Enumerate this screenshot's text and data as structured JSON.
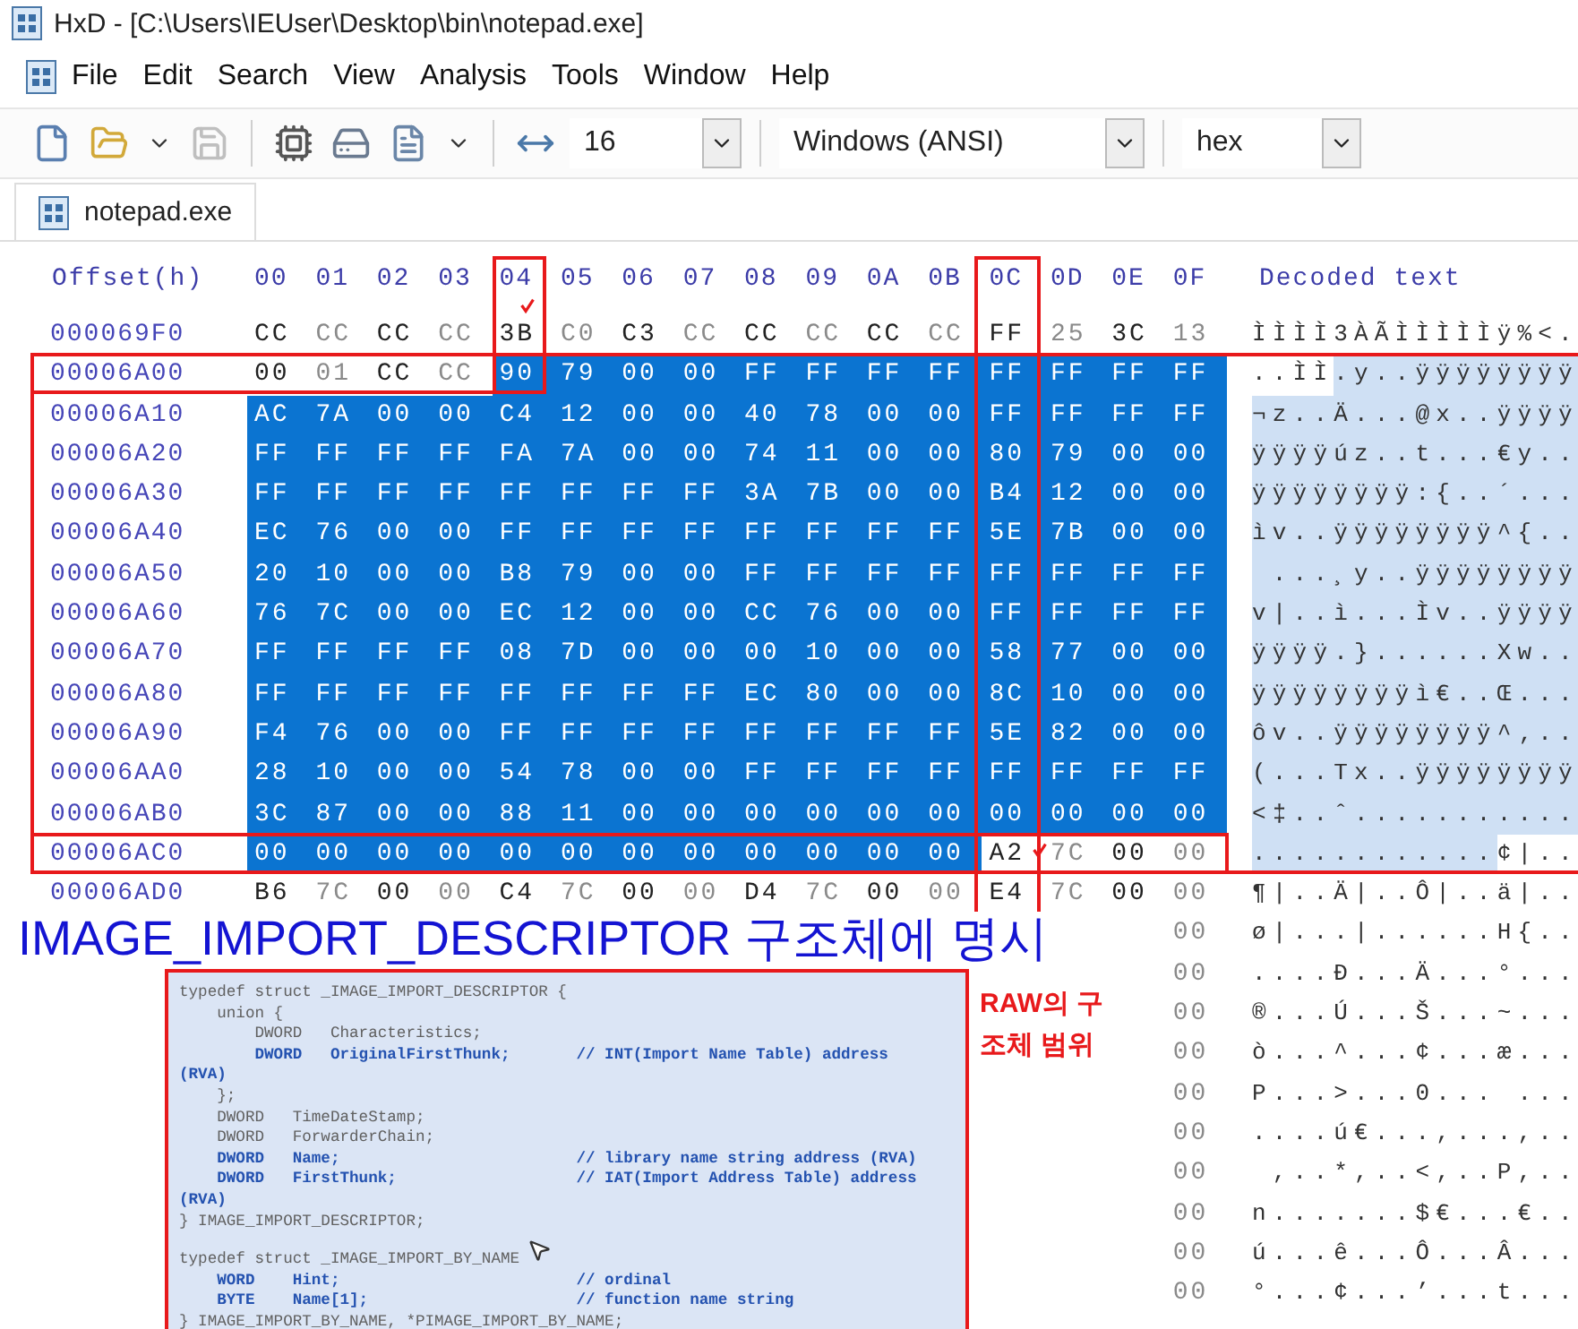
{
  "window": {
    "title": "HxD - [C:\\Users\\IEUser\\Desktop\\bin\\notepad.exe]"
  },
  "menu": [
    "File",
    "Edit",
    "Search",
    "View",
    "Analysis",
    "Tools",
    "Window",
    "Help"
  ],
  "toolbar": {
    "bytes_per_row": "16",
    "encoding": "Windows (ANSI)",
    "offset_base": "hex"
  },
  "tabs": [
    {
      "label": "notepad.exe",
      "selected": true
    }
  ],
  "hex_view": {
    "offset_header": "Offset(h)",
    "columns": [
      "00",
      "01",
      "02",
      "03",
      "04",
      "05",
      "06",
      "07",
      "08",
      "09",
      "0A",
      "0B",
      "0C",
      "0D",
      "0E",
      "0F"
    ],
    "decoded_header": "Decoded text",
    "rows": [
      {
        "offset": "000069F0",
        "bytes": [
          "CC",
          "CC",
          "CC",
          "CC",
          "3B",
          "C0",
          "C3",
          "CC",
          "CC",
          "CC",
          "CC",
          "CC",
          "FF",
          "25",
          "3C",
          "13"
        ],
        "selected": [
          false,
          false,
          false,
          false,
          false,
          false,
          false,
          false,
          false,
          false,
          false,
          false,
          false,
          false,
          false,
          false
        ],
        "decoded": "ÌÌÌÌ3ÀÃÌÌÌÌÌÿ%<."
      },
      {
        "offset": "00006A00",
        "bytes": [
          "00",
          "01",
          "CC",
          "CC",
          "90",
          "79",
          "00",
          "00",
          "FF",
          "FF",
          "FF",
          "FF",
          "FF",
          "FF",
          "FF",
          "FF"
        ],
        "selected": [
          false,
          false,
          false,
          false,
          true,
          true,
          true,
          true,
          true,
          true,
          true,
          true,
          true,
          true,
          true,
          true
        ],
        "decoded": "..ÌÌ.y..ÿÿÿÿÿÿÿÿ"
      },
      {
        "offset": "00006A10",
        "bytes": [
          "AC",
          "7A",
          "00",
          "00",
          "C4",
          "12",
          "00",
          "00",
          "40",
          "78",
          "00",
          "00",
          "FF",
          "FF",
          "FF",
          "FF"
        ],
        "selected": [
          true,
          true,
          true,
          true,
          true,
          true,
          true,
          true,
          true,
          true,
          true,
          true,
          true,
          true,
          true,
          true
        ],
        "decoded": "¬z..Ä...@x..ÿÿÿÿ"
      },
      {
        "offset": "00006A20",
        "bytes": [
          "FF",
          "FF",
          "FF",
          "FF",
          "FA",
          "7A",
          "00",
          "00",
          "74",
          "11",
          "00",
          "00",
          "80",
          "79",
          "00",
          "00"
        ],
        "selected": [
          true,
          true,
          true,
          true,
          true,
          true,
          true,
          true,
          true,
          true,
          true,
          true,
          true,
          true,
          true,
          true
        ],
        "decoded": "ÿÿÿÿúz..t...€y.."
      },
      {
        "offset": "00006A30",
        "bytes": [
          "FF",
          "FF",
          "FF",
          "FF",
          "FF",
          "FF",
          "FF",
          "FF",
          "3A",
          "7B",
          "00",
          "00",
          "B4",
          "12",
          "00",
          "00"
        ],
        "selected": [
          true,
          true,
          true,
          true,
          true,
          true,
          true,
          true,
          true,
          true,
          true,
          true,
          true,
          true,
          true,
          true
        ],
        "decoded": "ÿÿÿÿÿÿÿÿ:{..´..."
      },
      {
        "offset": "00006A40",
        "bytes": [
          "EC",
          "76",
          "00",
          "00",
          "FF",
          "FF",
          "FF",
          "FF",
          "FF",
          "FF",
          "FF",
          "FF",
          "5E",
          "7B",
          "00",
          "00"
        ],
        "selected": [
          true,
          true,
          true,
          true,
          true,
          true,
          true,
          true,
          true,
          true,
          true,
          true,
          true,
          true,
          true,
          true
        ],
        "decoded": "ìv..ÿÿÿÿÿÿÿÿ^{.."
      },
      {
        "offset": "00006A50",
        "bytes": [
          "20",
          "10",
          "00",
          "00",
          "B8",
          "79",
          "00",
          "00",
          "FF",
          "FF",
          "FF",
          "FF",
          "FF",
          "FF",
          "FF",
          "FF"
        ],
        "selected": [
          true,
          true,
          true,
          true,
          true,
          true,
          true,
          true,
          true,
          true,
          true,
          true,
          true,
          true,
          true,
          true
        ],
        "decoded": " ...¸y..ÿÿÿÿÿÿÿÿ"
      },
      {
        "offset": "00006A60",
        "bytes": [
          "76",
          "7C",
          "00",
          "00",
          "EC",
          "12",
          "00",
          "00",
          "CC",
          "76",
          "00",
          "00",
          "FF",
          "FF",
          "FF",
          "FF"
        ],
        "selected": [
          true,
          true,
          true,
          true,
          true,
          true,
          true,
          true,
          true,
          true,
          true,
          true,
          true,
          true,
          true,
          true
        ],
        "decoded": "v|..ì...Ìv..ÿÿÿÿ"
      },
      {
        "offset": "00006A70",
        "bytes": [
          "FF",
          "FF",
          "FF",
          "FF",
          "08",
          "7D",
          "00",
          "00",
          "00",
          "10",
          "00",
          "00",
          "58",
          "77",
          "00",
          "00"
        ],
        "selected": [
          true,
          true,
          true,
          true,
          true,
          true,
          true,
          true,
          true,
          true,
          true,
          true,
          true,
          true,
          true,
          true
        ],
        "decoded": "ÿÿÿÿ.}......Xw.."
      },
      {
        "offset": "00006A80",
        "bytes": [
          "FF",
          "FF",
          "FF",
          "FF",
          "FF",
          "FF",
          "FF",
          "FF",
          "EC",
          "80",
          "00",
          "00",
          "8C",
          "10",
          "00",
          "00"
        ],
        "selected": [
          true,
          true,
          true,
          true,
          true,
          true,
          true,
          true,
          true,
          true,
          true,
          true,
          true,
          true,
          true,
          true
        ],
        "decoded": "ÿÿÿÿÿÿÿÿì€..Œ..."
      },
      {
        "offset": "00006A90",
        "bytes": [
          "F4",
          "76",
          "00",
          "00",
          "FF",
          "FF",
          "FF",
          "FF",
          "FF",
          "FF",
          "FF",
          "FF",
          "5E",
          "82",
          "00",
          "00"
        ],
        "selected": [
          true,
          true,
          true,
          true,
          true,
          true,
          true,
          true,
          true,
          true,
          true,
          true,
          true,
          true,
          true,
          true
        ],
        "decoded": "ôv..ÿÿÿÿÿÿÿÿ^‚.."
      },
      {
        "offset": "00006AA0",
        "bytes": [
          "28",
          "10",
          "00",
          "00",
          "54",
          "78",
          "00",
          "00",
          "FF",
          "FF",
          "FF",
          "FF",
          "FF",
          "FF",
          "FF",
          "FF"
        ],
        "selected": [
          true,
          true,
          true,
          true,
          true,
          true,
          true,
          true,
          true,
          true,
          true,
          true,
          true,
          true,
          true,
          true
        ],
        "decoded": "(...Tx..ÿÿÿÿÿÿÿÿ"
      },
      {
        "offset": "00006AB0",
        "bytes": [
          "3C",
          "87",
          "00",
          "00",
          "88",
          "11",
          "00",
          "00",
          "00",
          "00",
          "00",
          "00",
          "00",
          "00",
          "00",
          "00"
        ],
        "selected": [
          true,
          true,
          true,
          true,
          true,
          true,
          true,
          true,
          true,
          true,
          true,
          true,
          true,
          true,
          true,
          true
        ],
        "decoded": "<‡..ˆ..........."
      },
      {
        "offset": "00006AC0",
        "bytes": [
          "00",
          "00",
          "00",
          "00",
          "00",
          "00",
          "00",
          "00",
          "00",
          "00",
          "00",
          "00",
          "A2",
          "7C",
          "00",
          "00"
        ],
        "selected": [
          true,
          true,
          true,
          true,
          true,
          true,
          true,
          true,
          true,
          true,
          true,
          true,
          false,
          false,
          false,
          false
        ],
        "decoded": "............¢|.."
      },
      {
        "offset": "00006AD0",
        "bytes": [
          "B6",
          "7C",
          "00",
          "00",
          "C4",
          "7C",
          "00",
          "00",
          "D4",
          "7C",
          "00",
          "00",
          "E4",
          "7C",
          "00",
          "00"
        ],
        "selected": [
          false,
          false,
          false,
          false,
          false,
          false,
          false,
          false,
          false,
          false,
          false,
          false,
          false,
          false,
          false,
          false
        ],
        "decoded": "¶|..Ä|..Ô|..ä|.."
      }
    ],
    "covered_rows": [
      {
        "last_byte": "00",
        "decoded": "ø|...|......H{.."
      },
      {
        "last_byte": "00",
        "decoded": "....Ð...Ä...°..."
      },
      {
        "last_byte": "00",
        "decoded": "®...Ú...Š...~..."
      },
      {
        "last_byte": "00",
        "decoded": "ò...^...¢...æ..."
      },
      {
        "last_byte": "00",
        "decoded": "P...>...0... ..."
      },
      {
        "last_byte": "00",
        "decoded": "....ú€...,...,.."
      },
      {
        "last_byte": "00",
        "decoded": " ,..*,..<,..P,.."
      },
      {
        "last_byte": "00",
        "decoded": "n.......$€...€.."
      },
      {
        "last_byte": "00",
        "decoded": "ú...ê...Ô...Â..."
      },
      {
        "last_byte": "00",
        "decoded": "°...¢...’...t..."
      }
    ]
  },
  "annotation": {
    "heading": "IMAGE_IMPORT_DESCRIPTOR 구조체에 명시",
    "note": "RAW의 구조체 범위",
    "code_lines": [
      {
        "text": "typedef struct _IMAGE_IMPORT_DESCRIPTOR {",
        "kind": "plain"
      },
      {
        "text": "    union {",
        "kind": "plain"
      },
      {
        "text": "        DWORD   Characteristics;",
        "kind": "plain"
      },
      {
        "text": "        DWORD   OriginalFirstThunk;       // INT(Import Name Table) address",
        "kind": "strong"
      },
      {
        "text": "(RVA)",
        "kind": "strong"
      },
      {
        "text": "    };",
        "kind": "plain"
      },
      {
        "text": "    DWORD   TimeDateStamp;",
        "kind": "plain"
      },
      {
        "text": "    DWORD   ForwarderChain;",
        "kind": "plain"
      },
      {
        "text": "    DWORD   Name;                         // library name string address (RVA)",
        "kind": "strong"
      },
      {
        "text": "    DWORD   FirstThunk;                   // IAT(Import Address Table) address",
        "kind": "strong"
      },
      {
        "text": "(RVA)",
        "kind": "strong"
      },
      {
        "text": "} IMAGE_IMPORT_DESCRIPTOR;",
        "kind": "plain"
      },
      {
        "text": "typedef struct _IMAGE_IMPORT_BY_NAME",
        "kind": "plain",
        "section_start": true
      },
      {
        "text": "    WORD    Hint;                         // ordinal",
        "kind": "strong"
      },
      {
        "text": "    BYTE    Name[1];                      // function name string",
        "kind": "strong"
      },
      {
        "text": "} IMAGE_IMPORT_BY_NAME, *PIMAGE_IMPORT_BY_NAME;",
        "kind": "plain"
      }
    ]
  }
}
